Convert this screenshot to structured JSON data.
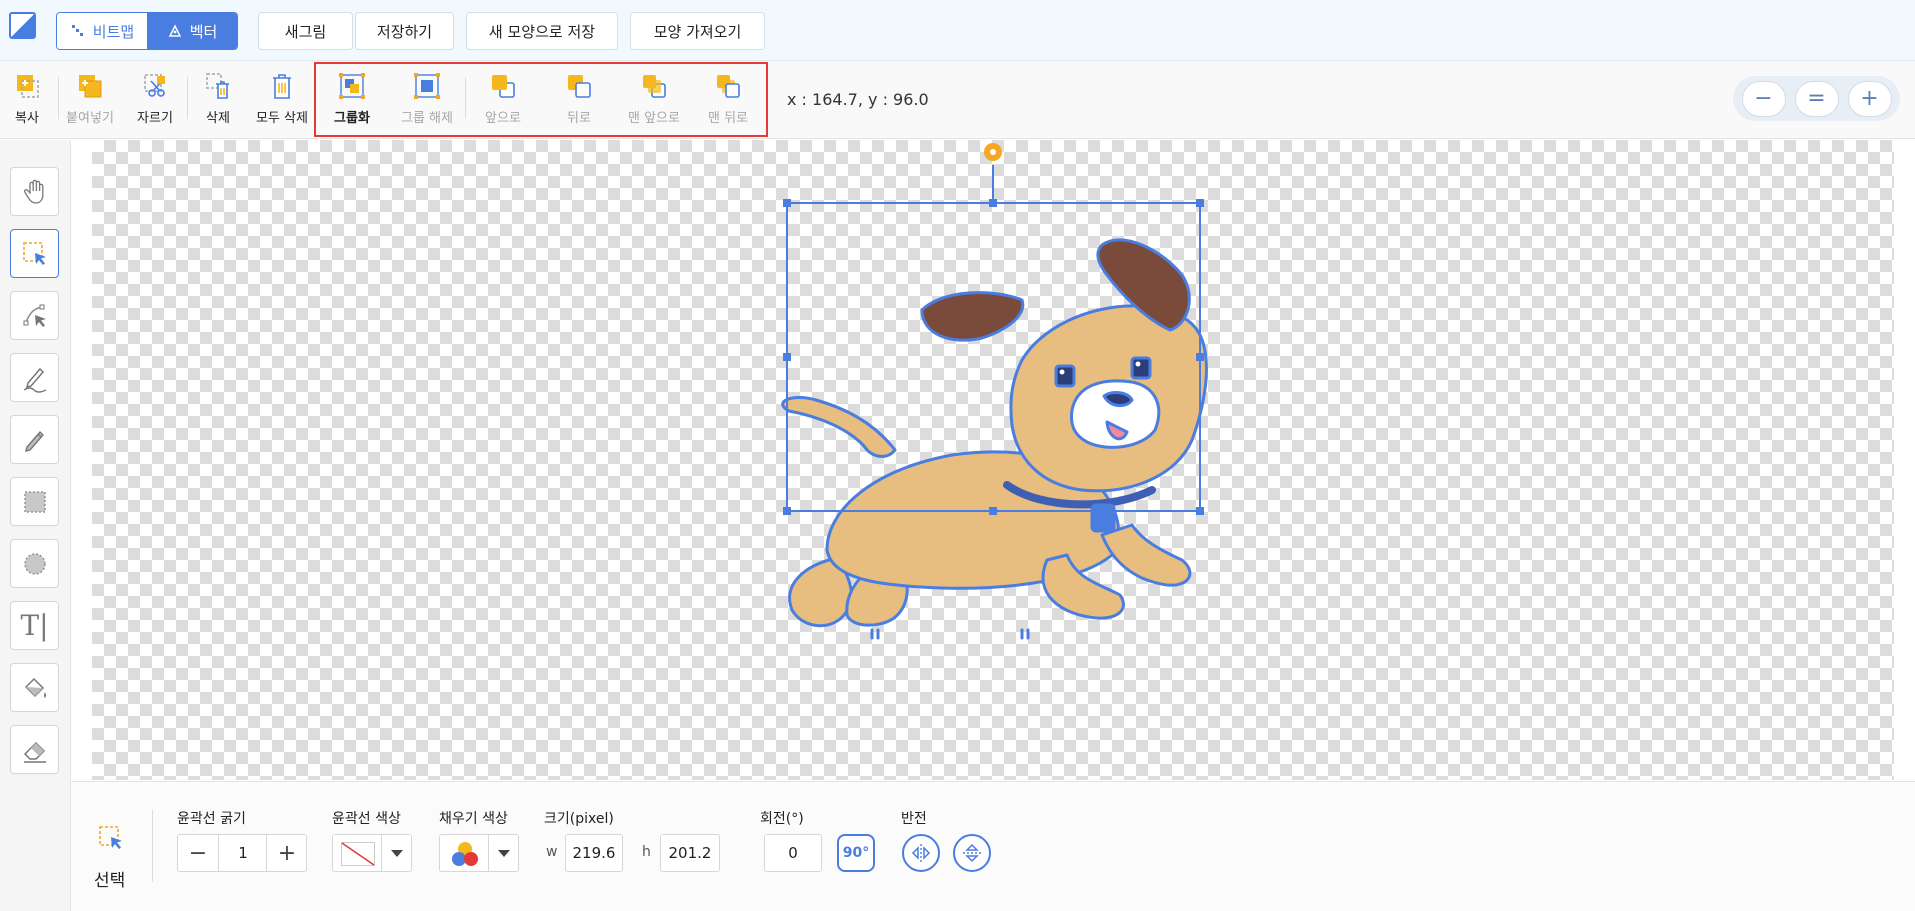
{
  "header": {
    "mode_bitmap": "비트맵",
    "mode_vector": "벡터",
    "buttons": [
      "새그림",
      "저장하기",
      "새 모양으로 저장",
      "모양 가져오기"
    ]
  },
  "toolbar": {
    "copy": "복사",
    "paste": "붙여넣기",
    "cut": "자르기",
    "delete": "삭제",
    "delete_all": "모두 삭제",
    "group": "그룹화",
    "ungroup": "그룹 해제",
    "forward": "앞으로",
    "backward": "뒤로",
    "to_front": "맨 앞으로",
    "to_back": "맨 뒤로",
    "coords": "x : 164.7, y : 96.0",
    "zoom_out": "−",
    "zoom_reset": "=",
    "zoom_in": "+"
  },
  "side_tools": [
    "hand",
    "select",
    "reshape",
    "pen",
    "brush",
    "rectangle",
    "circle",
    "text",
    "fill",
    "eraser"
  ],
  "bottom": {
    "current_tool": "선택",
    "outline_width_label": "윤곽선 굵기",
    "outline_width": "1",
    "outline_color_label": "윤곽선 색상",
    "fill_color_label": "채우기 색상",
    "size_label": "크기(pixel)",
    "w_label": "w",
    "w_value": "219.6",
    "h_label": "h",
    "h_value": "201.2",
    "rotate_label": "회전(°)",
    "rotate_value": "0",
    "rotate_90": "90°",
    "flip_label": "반전"
  },
  "colors": {
    "accent": "#4a7de0",
    "highlight": "#e53935",
    "fill": "#e8bd80",
    "ear": "#7a4a3a",
    "handle": "#f5a623"
  }
}
